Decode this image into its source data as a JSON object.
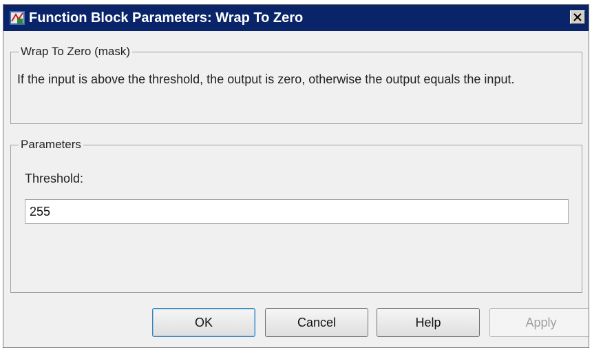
{
  "window": {
    "title": "Function Block Parameters: Wrap To Zero",
    "icon": "simulink-block-icon",
    "close_icon": "close-icon"
  },
  "mask_group": {
    "legend": "Wrap To Zero (mask)",
    "description": "If the input is above the threshold, the output is zero, otherwise the output equals the input."
  },
  "parameters_group": {
    "legend": "Parameters",
    "threshold_label": "Threshold:",
    "threshold_value": "255"
  },
  "buttons": {
    "ok": "OK",
    "cancel": "Cancel",
    "help": "Help",
    "apply": "Apply"
  }
}
